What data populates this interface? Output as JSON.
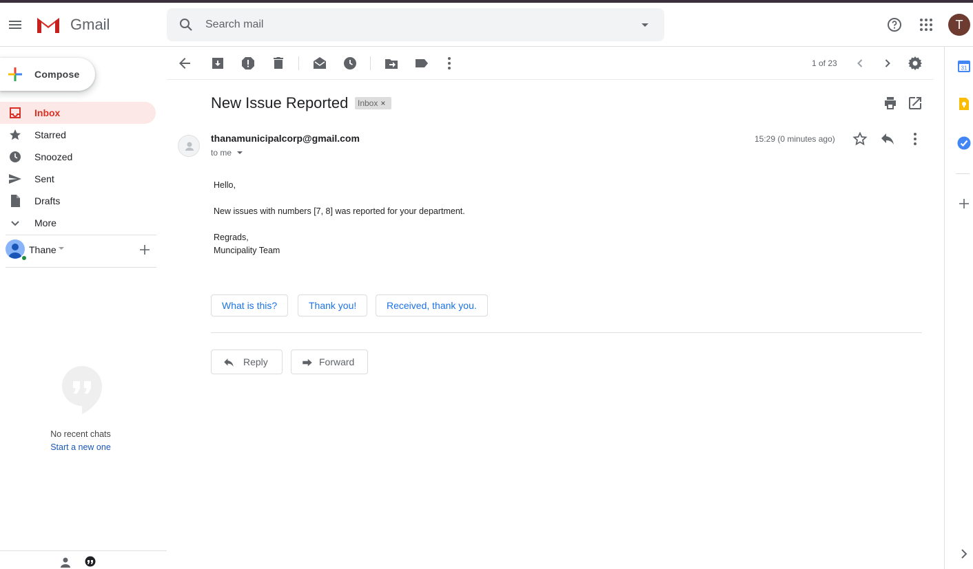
{
  "app": {
    "name": "Gmail",
    "account_initial": "T"
  },
  "search": {
    "placeholder": "Search mail"
  },
  "sidebar": {
    "compose_label": "Compose",
    "items": [
      {
        "label": "Inbox",
        "icon": "inbox-icon",
        "active": true
      },
      {
        "label": "Starred",
        "icon": "star-icon"
      },
      {
        "label": "Snoozed",
        "icon": "clock-icon"
      },
      {
        "label": "Sent",
        "icon": "send-icon"
      },
      {
        "label": "Drafts",
        "icon": "draft-icon"
      },
      {
        "label": "More",
        "icon": "chevron-down-icon"
      }
    ],
    "hangouts_user": "Thane",
    "no_chats": "No recent chats",
    "start_new": "Start a new one"
  },
  "toolbar": {
    "page_count": "1 of 23"
  },
  "message": {
    "subject": "New Issue Reported",
    "label": "Inbox",
    "sender": "thanamunicipalcorp@gmail.com",
    "to": "to me",
    "time": "15:29 (0 minutes ago)",
    "body": {
      "greeting": "Hello,",
      "line1": "New issues with numbers [7, 8] was reported for your department.",
      "signoff": "Regrads,",
      "team": "Muncipality Team"
    },
    "smart_replies": [
      "What is this?",
      "Thank you!",
      "Received, thank you."
    ],
    "reply_label": "Reply",
    "forward_label": "Forward"
  },
  "colors": {
    "accent_red": "#d93025",
    "link_blue": "#1a73e8",
    "inbox_bg": "#fce8e6"
  }
}
